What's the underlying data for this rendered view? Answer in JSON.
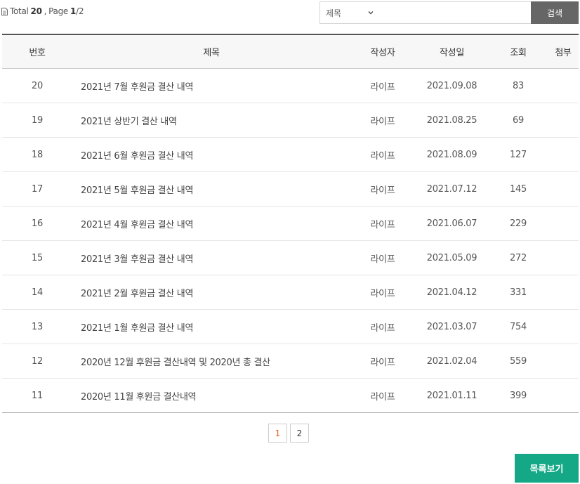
{
  "summary": {
    "total_label": "Total",
    "total_count": "20",
    "page_label": "Page",
    "page_current": "1",
    "page_total": "/2"
  },
  "search": {
    "field_selected": "제목",
    "button_label": "검색"
  },
  "table": {
    "headers": {
      "no": "번호",
      "subject": "제목",
      "author": "작성자",
      "date": "작성일",
      "views": "조회",
      "attach": "첨부"
    },
    "rows": [
      {
        "no": "20",
        "subject": "2021년 7월 후원금 결산 내역",
        "author": "라이프",
        "date": "2021.09.08",
        "views": "83",
        "attach": ""
      },
      {
        "no": "19",
        "subject": "2021년 상반기 결산 내역",
        "author": "라이프",
        "date": "2021.08.25",
        "views": "69",
        "attach": ""
      },
      {
        "no": "18",
        "subject": "2021년 6월 후원금 결산 내역",
        "author": "라이프",
        "date": "2021.08.09",
        "views": "127",
        "attach": ""
      },
      {
        "no": "17",
        "subject": "2021년 5월 후원금 결산 내역",
        "author": "라이프",
        "date": "2021.07.12",
        "views": "145",
        "attach": ""
      },
      {
        "no": "16",
        "subject": "2021년 4월 후원금 결산 내역",
        "author": "라이프",
        "date": "2021.06.07",
        "views": "229",
        "attach": ""
      },
      {
        "no": "15",
        "subject": "2021년 3월 후원금 결산 내역",
        "author": "라이프",
        "date": "2021.05.09",
        "views": "272",
        "attach": ""
      },
      {
        "no": "14",
        "subject": "2021년 2월 후원금 결산 내역",
        "author": "라이프",
        "date": "2021.04.12",
        "views": "331",
        "attach": ""
      },
      {
        "no": "13",
        "subject": "2021년 1월 후원금 결산 내역",
        "author": "라이프",
        "date": "2021.03.07",
        "views": "754",
        "attach": ""
      },
      {
        "no": "12",
        "subject": "2020년 12월 후원금 결산내역 및 2020년 총 결산",
        "author": "라이프",
        "date": "2021.02.04",
        "views": "559",
        "attach": ""
      },
      {
        "no": "11",
        "subject": "2020년 11월 후원금 결산내역",
        "author": "라이프",
        "date": "2021.01.11",
        "views": "399",
        "attach": ""
      }
    ]
  },
  "pagination": {
    "pages": [
      "1",
      "2"
    ],
    "current": "1"
  },
  "footer": {
    "list_button_label": "목록보기"
  },
  "colors": {
    "accent": "#15a887",
    "active_page": "#e8601c",
    "search_button": "#666666"
  },
  "icons": {
    "summary": "document-icon",
    "select": "chevron-down-icon"
  }
}
